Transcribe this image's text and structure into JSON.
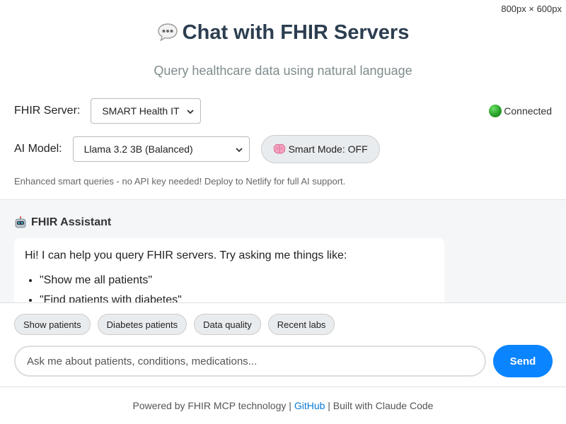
{
  "viewport_label": "800px × 600px",
  "header": {
    "title": "Chat with FHIR Servers",
    "subtitle": "Query healthcare data using natural language",
    "icon": "speech-bubble-icon"
  },
  "controls": {
    "server_label": "FHIR Server:",
    "server_selected": "SMART Health IT",
    "status_text": "Connected",
    "status_color": "#28a228",
    "model_label": "AI Model:",
    "model_selected": "Llama 3.2 3B (Balanced)",
    "smart_mode_label": "Smart Mode: OFF",
    "hint": "Enhanced smart queries - no API key needed! Deploy to Netlify for full AI support."
  },
  "chat": {
    "assistant_name": "FHIR Assistant",
    "message_intro": "Hi! I can help you query FHIR servers. Try asking me things like:",
    "examples": [
      "\"Show me all patients\"",
      "\"Find patients with diabetes\""
    ]
  },
  "quick_actions": [
    "Show patients",
    "Diabetes patients",
    "Data quality",
    "Recent labs"
  ],
  "input": {
    "placeholder": "Ask me about patients, conditions, medications...",
    "send_label": "Send"
  },
  "footer": {
    "prefix": "Powered by FHIR MCP technology |",
    "link": "GitHub",
    "suffix": "| Built with Claude Code"
  },
  "colors": {
    "accent": "#0a84ff",
    "title": "#2c3e50",
    "subtitle": "#7f8c8d"
  }
}
